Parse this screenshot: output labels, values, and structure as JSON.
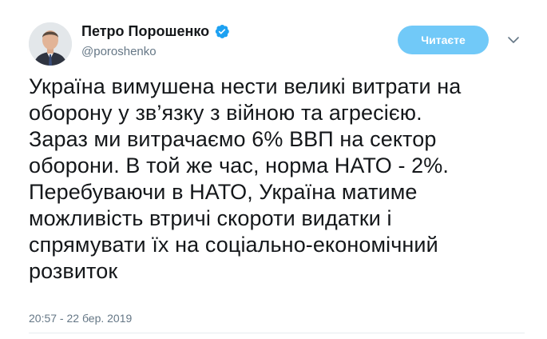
{
  "tweet": {
    "author": {
      "display_name": "Петро Порошенко",
      "handle": "@poroshenko",
      "verified_icon": "verified-badge-icon",
      "avatar_icon": "profile-photo"
    },
    "follow_button_label": "Читаєте",
    "caret_icon": "chevron-down-icon",
    "text": "Україна вимушена нести великі витрати на\nоборону у зв’язку з війною та агресією.\nЗараз ми витрачаємо 6% ВВП на сектор\nоборони. В той же час,  норма НАТО - 2%.\nПеребуваючи в НАТО, Україна матиме\nможливість втричі скороти видатки і\nспрямувати їх на соціально-економічний\nрозвиток",
    "timestamp": "20:57 - 22 бер. 2019"
  },
  "colors": {
    "accent": "#1da1f2",
    "follow_button_bg": "#71c9f8",
    "secondary_text": "#657786"
  }
}
